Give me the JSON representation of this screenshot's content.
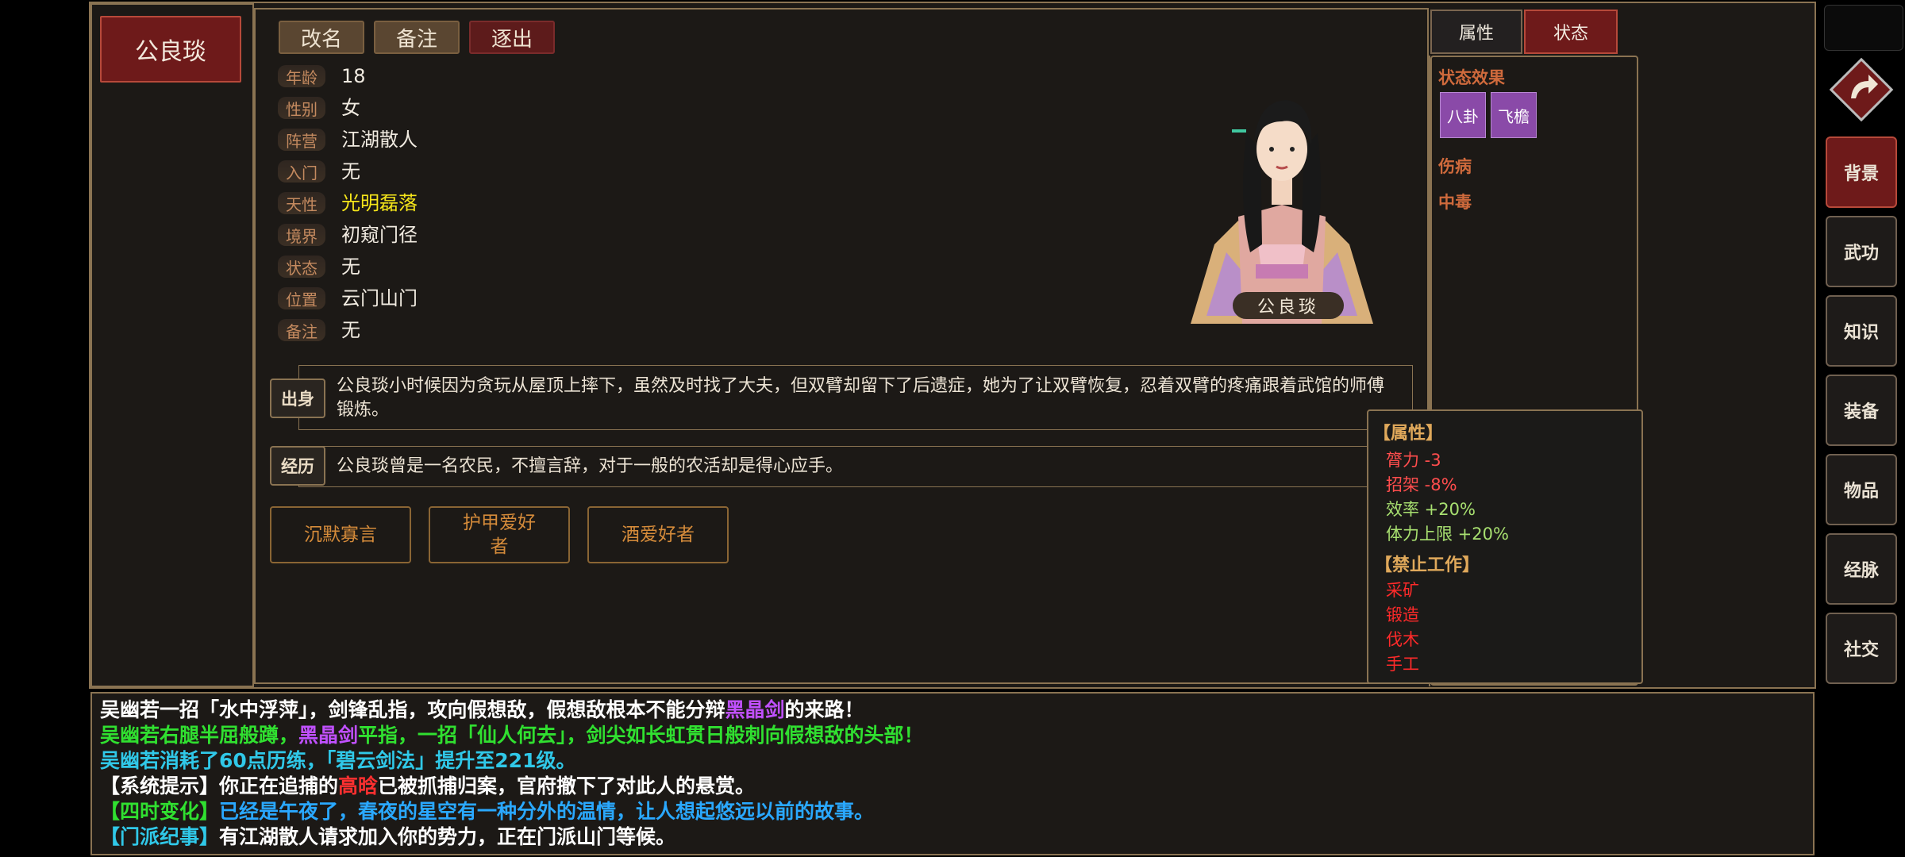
{
  "character": {
    "name": "公良琰",
    "portrait_label": "公良琰",
    "actions": [
      "改名",
      "备注",
      "逐出"
    ],
    "fields": [
      {
        "label": "年龄",
        "value": "18"
      },
      {
        "label": "性别",
        "value": "女"
      },
      {
        "label": "阵营",
        "value": "江湖散人"
      },
      {
        "label": "入门",
        "value": "无"
      },
      {
        "label": "天性",
        "value": "光明磊落"
      },
      {
        "label": "境界",
        "value": "初窥门径"
      },
      {
        "label": "状态",
        "value": "无"
      },
      {
        "label": "位置",
        "value": "云门山门"
      },
      {
        "label": "备注",
        "value": "无"
      }
    ],
    "background": {
      "tag": "出身",
      "text": "公良琰小时候因为贪玩从屋顶上摔下，虽然及时找了大夫，但双臂却留下了后遗症，她为了让双臂恢复，忍着双臂的疼痛跟着武馆的师傅锻炼。"
    },
    "experience": {
      "tag": "经历",
      "text": "公良琰曾是一名农民，不擅言辞，对于一般的农活却是得心应手。"
    },
    "traits": [
      "沉默寡言",
      "护甲爱好者",
      "酒爱好者"
    ]
  },
  "right_tabs": [
    {
      "label": "属性",
      "active": false
    },
    {
      "label": "状态",
      "active": true
    }
  ],
  "status": {
    "effects_title": "状态效果",
    "effects": [
      "八卦",
      "飞檐"
    ],
    "injury": "伤病",
    "poison": "中毒"
  },
  "tooltip": {
    "attr_title": "【属性】",
    "attrs": [
      {
        "text": "膂力 -3",
        "color": "#ff4d4d"
      },
      {
        "text": "招架 -8%",
        "color": "#ff4d4d"
      },
      {
        "text": "效率 +20%",
        "color": "#a8e070"
      },
      {
        "text": "体力上限 +20%",
        "color": "#a8e070"
      }
    ],
    "ban_title": "【禁止工作】",
    "bans": [
      "采矿",
      "锻造",
      "伐木",
      "手工"
    ]
  },
  "side_menu": [
    {
      "label": "背景",
      "active": true
    },
    {
      "label": "武功",
      "active": false
    },
    {
      "label": "知识",
      "active": false
    },
    {
      "label": "装备",
      "active": false
    },
    {
      "label": "物品",
      "active": false
    },
    {
      "label": "经脉",
      "active": false
    },
    {
      "label": "社交",
      "active": false
    }
  ],
  "log": [
    [
      {
        "t": "吴幽若一招「水中浮萍」，剑锋乱指，攻向假想敌，假想敌根本不能分辩",
        "c": "#ffffff"
      },
      {
        "t": "黑晶剑",
        "c": "#c050ff"
      },
      {
        "t": "的来路！",
        "c": "#ffffff"
      }
    ],
    [
      {
        "t": "吴幽若右腿半屈般蹲，",
        "c": "#30e030"
      },
      {
        "t": "黑晶剑",
        "c": "#c050ff"
      },
      {
        "t": "平指，一招「仙人何去」，剑尖如长虹贯日般刺向假想敌的头部！",
        "c": "#30e030"
      }
    ],
    [
      {
        "t": "吴幽若消耗了60点历练，「碧云剑法」提升至221级。",
        "c": "#30c8e8"
      }
    ],
    [
      {
        "t": "【系统提示】你正在追捕的",
        "c": "#ffffff"
      },
      {
        "t": "高晗",
        "c": "#ff3030"
      },
      {
        "t": "已被抓捕归案，官府撤下了对此人的悬赏。",
        "c": "#ffffff"
      }
    ],
    [
      {
        "t": "【四时变化】",
        "c": "#30e030"
      },
      {
        "t": "已经是午夜了，春夜的星空有一种分外的温情，让人想起悠远以前的故事。",
        "c": "#2aa8ff"
      }
    ],
    [
      {
        "t": "【门派纪事】",
        "c": "#30c8e8"
      },
      {
        "t": "有江湖散人请求加入你的势力，正在门派山门等候。",
        "c": "#ffffff"
      }
    ]
  ]
}
